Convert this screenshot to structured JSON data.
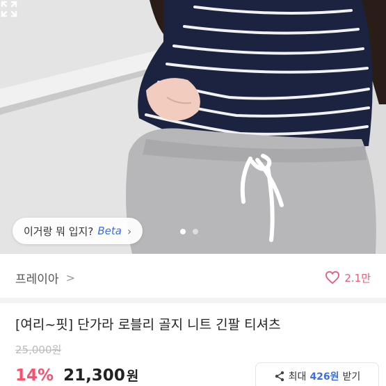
{
  "photo": {
    "ai_chip": {
      "label": "이거랑 뭐 입지?",
      "beta": "Beta"
    },
    "carousel": {
      "count": 2,
      "active_index": 0
    }
  },
  "shop": {
    "name": "프레이아",
    "likes": "2.1만"
  },
  "product": {
    "title": "[여리~핏] 단가라 로블리 골지 니트 긴팔 티셔츠",
    "original_price": "25,000원",
    "discount": "14%",
    "price": "21,300",
    "price_unit": "원"
  },
  "coupon": {
    "prefix": "최대",
    "amount": "426원",
    "suffix": "받기"
  },
  "colors": {
    "accent_pink": "#ff4d6d",
    "heart": "#e85a7a",
    "beta_blue": "#3d6fe0"
  }
}
